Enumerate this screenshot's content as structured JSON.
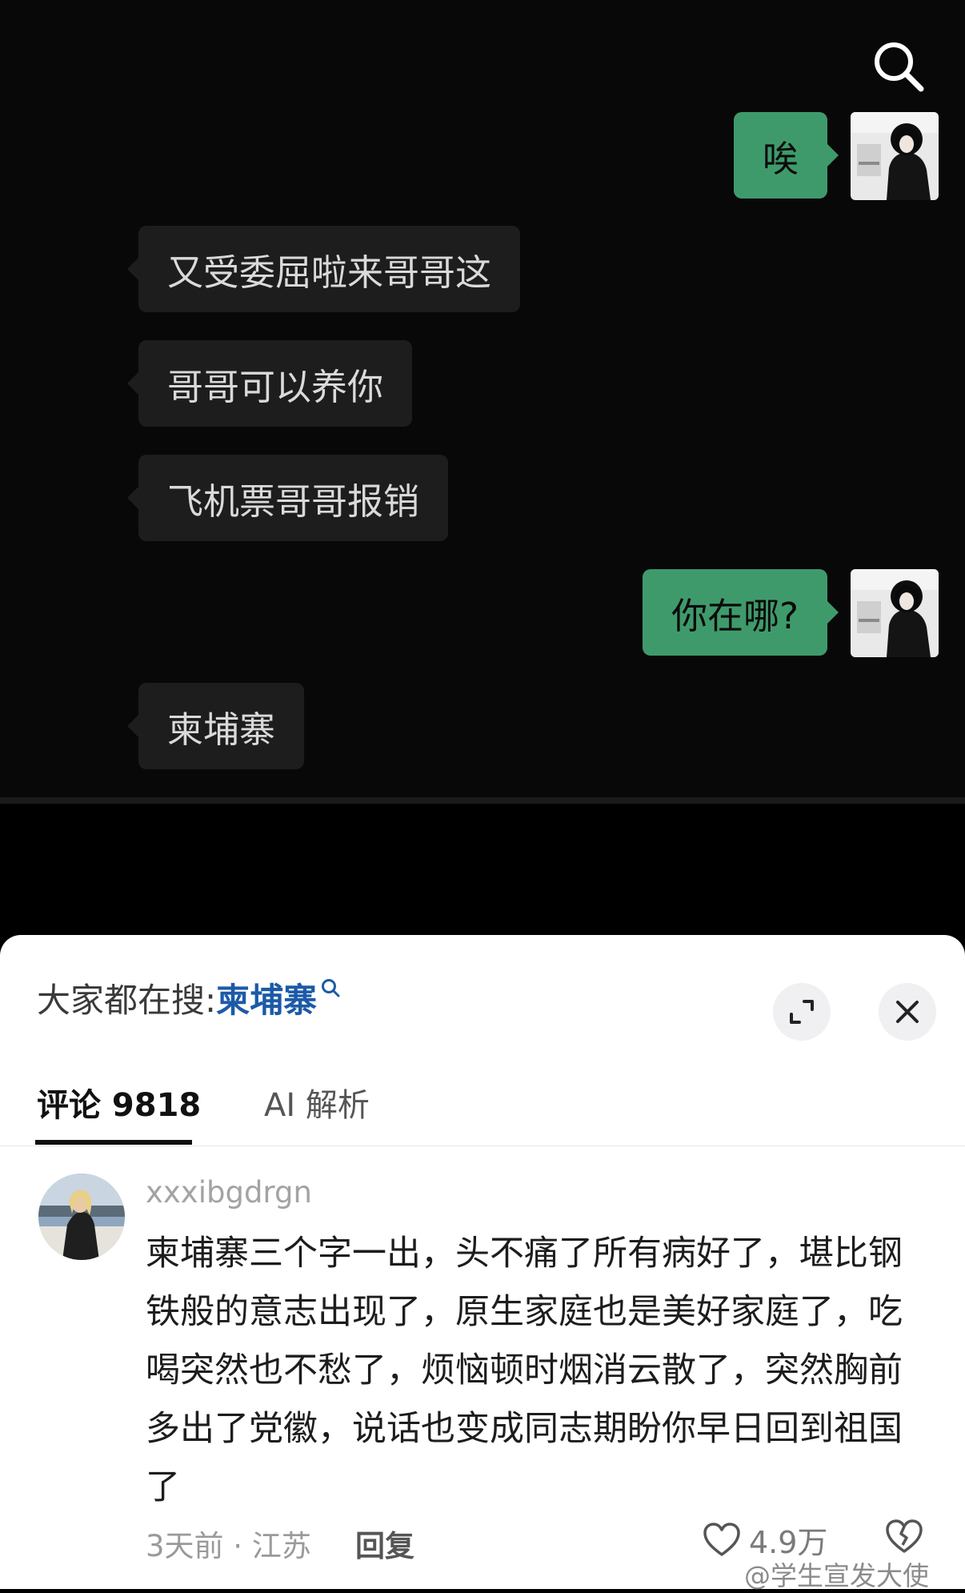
{
  "chat": {
    "messages": [
      {
        "side": "sent",
        "text": "唉"
      },
      {
        "side": "received",
        "text": "又受委屈啦来哥哥这"
      },
      {
        "side": "received",
        "text": "哥哥可以养你"
      },
      {
        "side": "received",
        "text": "飞机票哥哥报销"
      },
      {
        "side": "sent",
        "text": "你在哪?"
      },
      {
        "side": "received",
        "text": "柬埔寨"
      }
    ]
  },
  "panel": {
    "search_prefix": "大家都在搜:",
    "search_keyword": "柬埔寨",
    "tabs": [
      {
        "label": "评论 9818",
        "active": true
      },
      {
        "label": "AI 解析",
        "active": false
      }
    ]
  },
  "comment": {
    "username": "xxxibgdrgn",
    "text": "柬埔寨三个字一出，头不痛了所有病好了，堪比钢铁般的意志出现了，原生家庭也是美好家庭了，吃喝突然也不愁了，烦恼顿时烟消云散了，突然胸前多出了党徽，说话也变成同志期盼你早日回到祖国了",
    "meta": "3天前 · 江苏",
    "reply_label": "回复",
    "likes": "4.9万"
  },
  "watermark": "@学生宣发大使",
  "colors": {
    "sent_bubble": "#3f9a6b",
    "received_bubble": "#1d1d1d",
    "keyword": "#1c5aa8"
  }
}
